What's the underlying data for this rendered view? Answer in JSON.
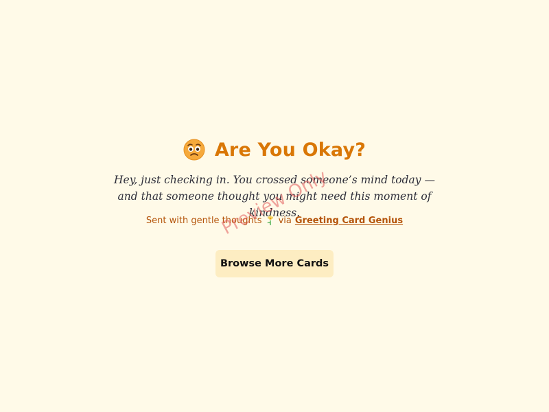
{
  "card": {
    "emoji": "worried-face-icon",
    "title": "Are You Okay?",
    "message": "Hey, just checking in. You crossed someone’s mind today — and that someone thought you might need this moment of kindness.",
    "sent_prefix": "Sent with gentle thoughts",
    "sent_icon": "flower-icon",
    "via_text": "via",
    "brand_link": "Greeting Card Genius"
  },
  "actions": {
    "browse_label": "Browse More Cards"
  },
  "watermark": {
    "text": "Preview Only"
  },
  "colors": {
    "background": "#fffae8",
    "title": "#d97706",
    "accent": "#b45309",
    "button_bg": "#fdedc2"
  }
}
